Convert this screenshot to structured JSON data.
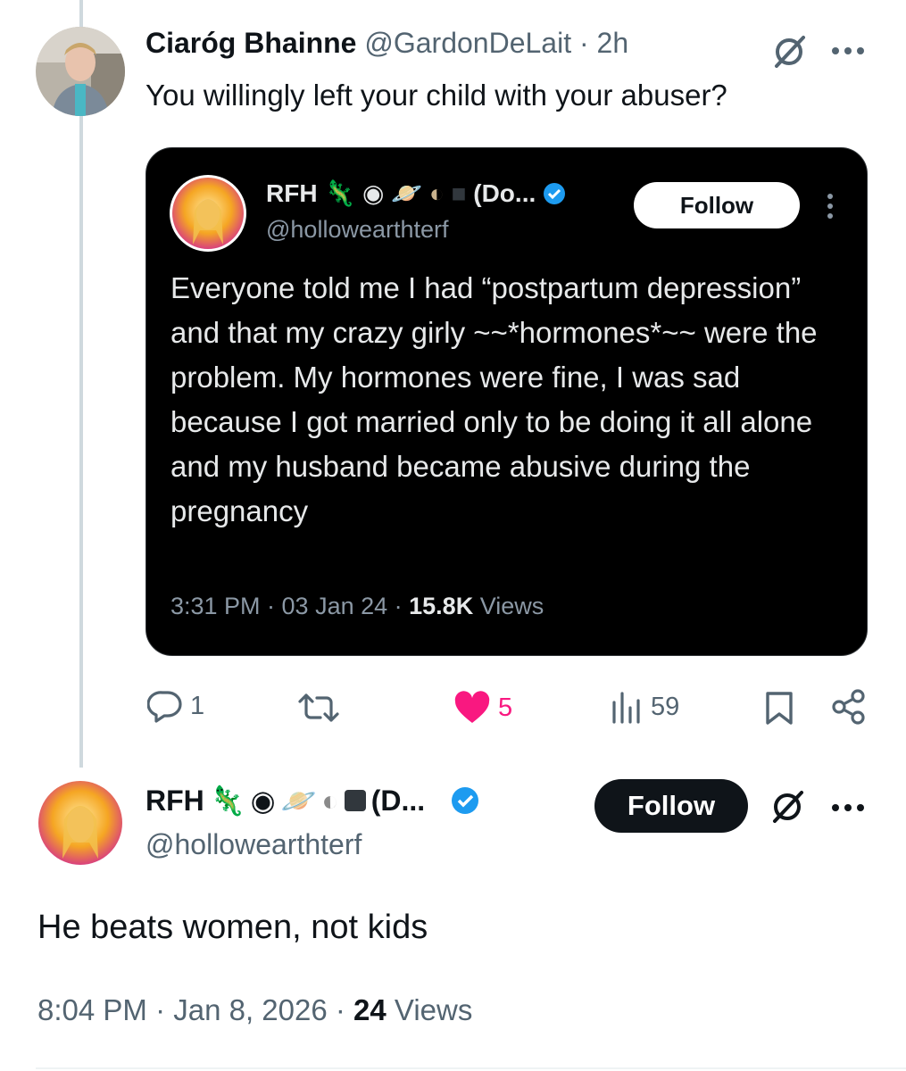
{
  "reply_tweet": {
    "author_name": "Ciaróg Bhainne",
    "handle": "@GardonDeLait",
    "separator": "·",
    "time": "2h",
    "text": "You willingly left your child with your abuser?",
    "quoted_card": {
      "name": "RFH",
      "name_suffix": "(Do...",
      "handle": "@hollowearthterf",
      "follow_label": "Follow",
      "body": "Everyone told me I had “postpartum depression” and that my crazy girly ~~*hormones*~~ were the problem. My hormones were fine, I was sad because I got married only to be doing it all alone and my husband became abusive during the pregnancy",
      "meta_time": "3:31 PM · 03 Jan 24 · ",
      "meta_views_count": "15.8K",
      "meta_views_label": " Views"
    },
    "actions": {
      "replies": "1",
      "likes": "5",
      "views": "59"
    }
  },
  "main_tweet": {
    "name": "RFH",
    "name_suffix": "(D...",
    "handle": "@hollowearthterf",
    "follow_label": "Follow",
    "text": "He beats women, not kids",
    "meta_time": "8:04 PM · Jan 8, 2026 · ",
    "meta_views_count": "24",
    "meta_views_label": " Views"
  },
  "colors": {
    "like_pink": "#f91880",
    "verified_blue": "#1d9bf0",
    "muted": "#536471"
  }
}
